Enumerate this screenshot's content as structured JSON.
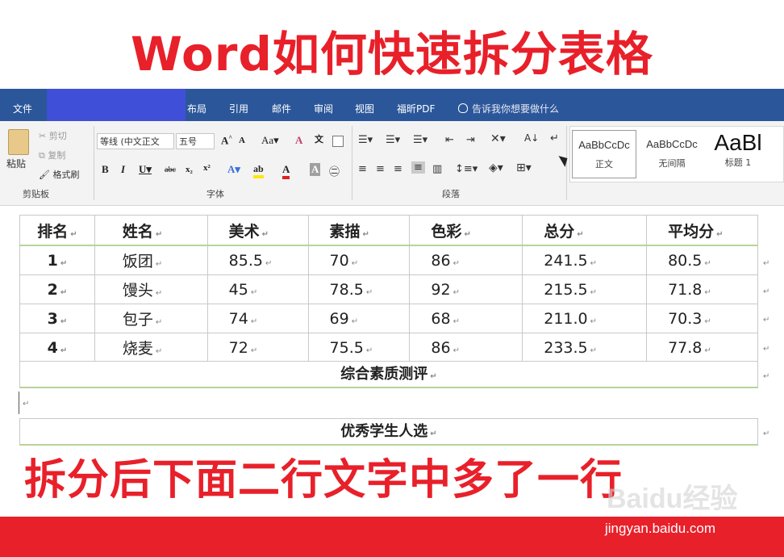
{
  "headline": "Word如何快速拆分表格",
  "ribbon": {
    "tabs": [
      "文件",
      "布局",
      "引用",
      "邮件",
      "审阅",
      "视图",
      "福昕PDF"
    ],
    "tell_me": "告诉我你想要做什么",
    "clipboard": {
      "paste": "粘贴",
      "cut": "剪切",
      "copy": "复制",
      "format_painter": "格式刷",
      "group": "剪贴板"
    },
    "font": {
      "font_name": "等线 (中文正文",
      "font_size": "五号",
      "group": "字体"
    },
    "paragraph": {
      "group": "段落"
    },
    "styles": [
      {
        "sample": "AaBbCcDc",
        "name": "正文"
      },
      {
        "sample": "AaBbCcDc",
        "name": "无间隔"
      },
      {
        "sample": "AaBl",
        "name": "标题 1"
      }
    ]
  },
  "table": {
    "headers": [
      "排名",
      "姓名",
      "美术",
      "素描",
      "色彩",
      "总分",
      "平均分"
    ],
    "rows": [
      [
        "1",
        "饭团",
        "85.5",
        "70",
        "86",
        "241.5",
        "80.5"
      ],
      [
        "2",
        "馒头",
        "45",
        "78.5",
        "92",
        "215.5",
        "71.8"
      ],
      [
        "3",
        "包子",
        "74",
        "69",
        "68",
        "211.0",
        "70.3"
      ],
      [
        "4",
        "烧麦",
        "72",
        "75.5",
        "86",
        "233.5",
        "77.8"
      ]
    ],
    "merged_row_1": "综合素质测评",
    "merged_row_2": "优秀学生人选"
  },
  "marks": {
    "cell": "↵",
    "para": "↵"
  },
  "caption": "拆分后下面二行文字中多了一行",
  "watermark": {
    "logo": "Baidu经验",
    "url": "jingyan.baidu.com"
  },
  "colors": {
    "accent_red": "#e8202a",
    "ribbon_blue": "#2b579a",
    "header_rule": "#b7d39a"
  }
}
